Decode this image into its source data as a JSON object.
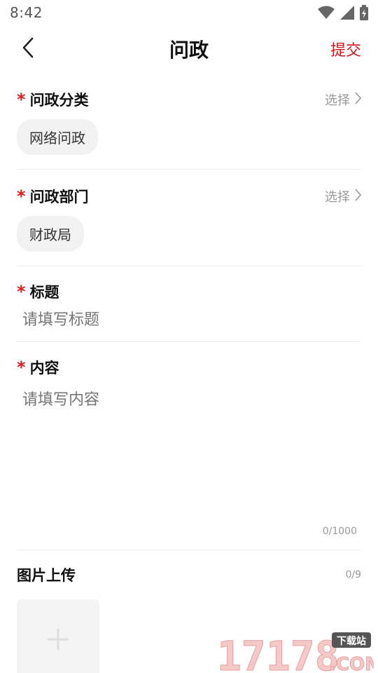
{
  "status_bar": {
    "time": "8:42",
    "icons": [
      "wifi-icon",
      "signal-icon",
      "battery-icon"
    ]
  },
  "header": {
    "title": "问政",
    "submit_label": "提交",
    "back_icon": "chevron-left-icon"
  },
  "form": {
    "category": {
      "label": "问政分类",
      "chooser": "选择",
      "selected": "网络问政"
    },
    "department": {
      "label": "问政部门",
      "chooser": "选择",
      "selected": "财政局"
    },
    "title": {
      "label": "标题",
      "placeholder": "请填写标题"
    },
    "content": {
      "label": "内容",
      "placeholder": "请填写内容",
      "counter": "0/1000"
    },
    "images": {
      "label": "图片上传",
      "counter": "0/9"
    },
    "required_mark": "*"
  },
  "watermark": {
    "numbers": "17178",
    "tag": "下载站",
    "suffix": ".COM"
  },
  "colors": {
    "accent": "#d1171e",
    "star": "#e01b22",
    "placeholder": "#999999",
    "chip_bg": "#f2f2f2"
  }
}
